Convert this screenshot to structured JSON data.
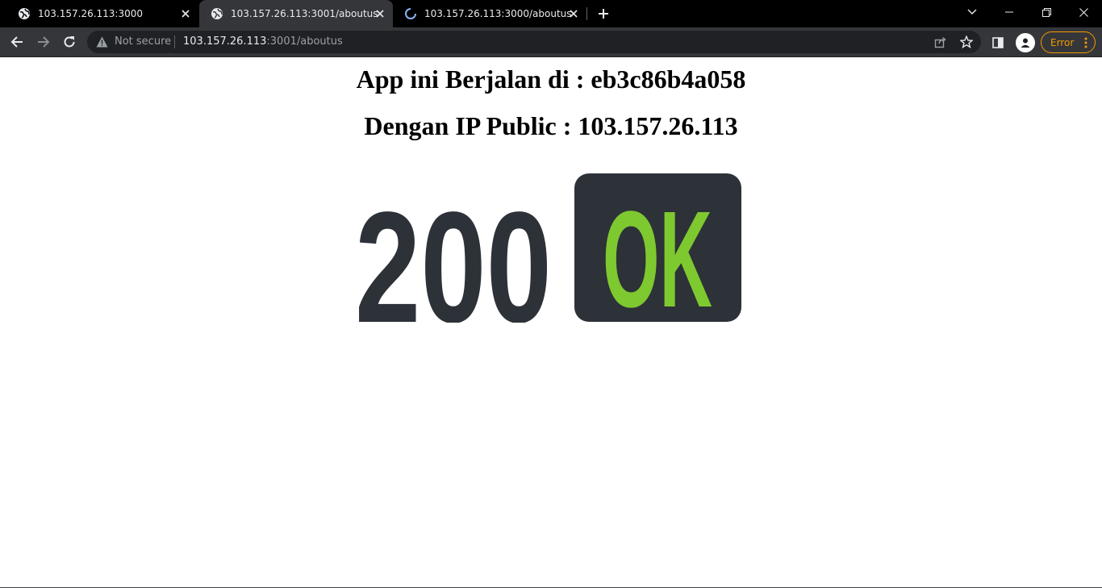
{
  "tabs": [
    {
      "title": "103.157.26.113:3000",
      "icon": "globe-icon",
      "active": false
    },
    {
      "title": "103.157.26.113:3001/aboutus",
      "icon": "globe-icon",
      "active": true
    },
    {
      "title": "103.157.26.113:3000/aboutus",
      "icon": "loading-spinner-icon",
      "active": false
    }
  ],
  "omnibox": {
    "security_label": "Not secure",
    "url_host": "103.157.26.113",
    "url_rest": ":3001/aboutus"
  },
  "toolbar": {
    "error_label": "Error"
  },
  "content": {
    "heading_host": "App ini Berjalan di : eb3c86b4a058",
    "heading_ip": "Dengan IP Public : 103.157.26.113",
    "status_code": "200",
    "status_text": "OK"
  },
  "colors": {
    "tabstrip_bg": "#000000",
    "toolbar_bg": "#35363a",
    "omnibox_bg": "#202124",
    "error_accent": "#f29900",
    "status_dark": "#2d3138",
    "status_green": "#7ec92f"
  }
}
